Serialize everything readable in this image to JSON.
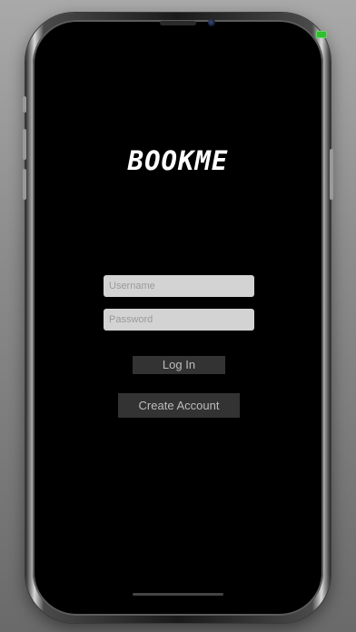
{
  "app": {
    "title": "BOOKME"
  },
  "login_form": {
    "username_placeholder": "Username",
    "username_value": "",
    "password_placeholder": "Password",
    "password_value": "",
    "login_label": "Log In",
    "create_account_label": "Create Account"
  },
  "status_bar": {
    "battery_icon": "battery-charging-icon",
    "battery_color": "#2fbf2f"
  },
  "theme": {
    "background": "#000000",
    "title_color": "#ffffff",
    "field_color": "#d3d3d3",
    "button_color": "#333333",
    "button_text_color": "#bdbdbd"
  }
}
